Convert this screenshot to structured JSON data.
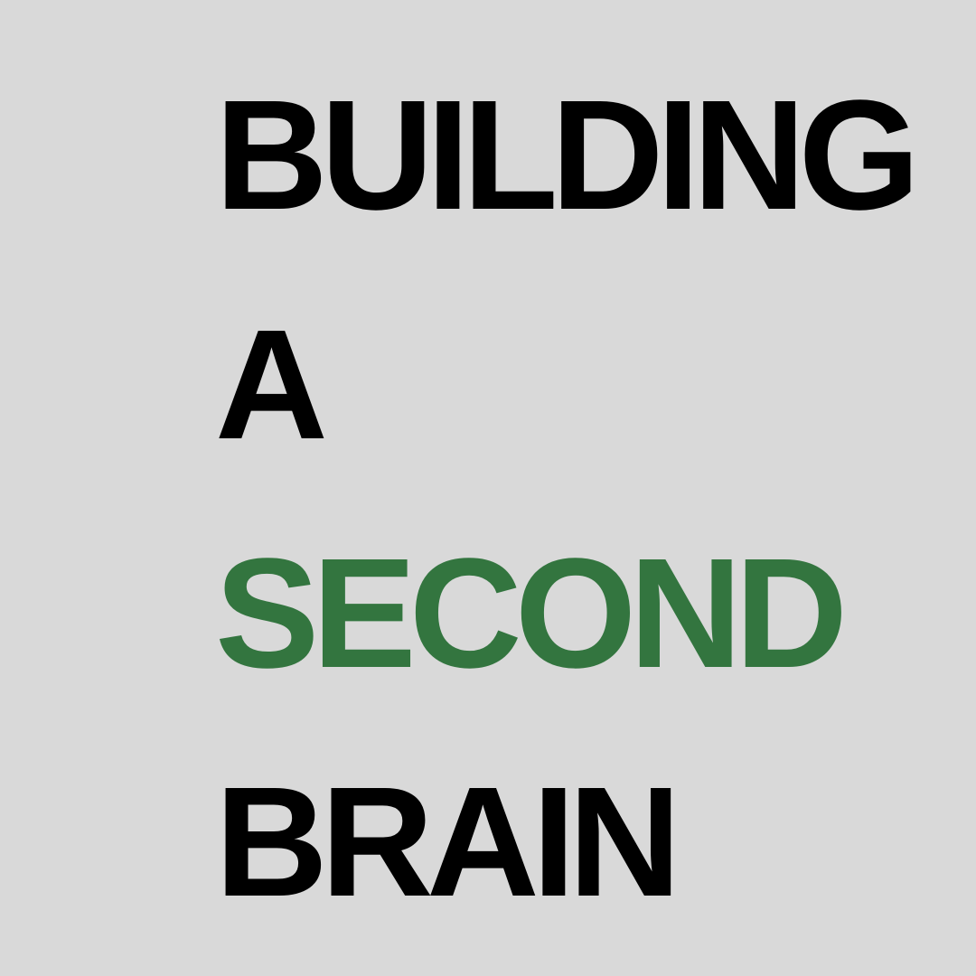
{
  "title_lines": {
    "line1": "BUILDING",
    "line2": "A",
    "line3": "SECOND",
    "line4": "BRAIN"
  },
  "colors": {
    "background": "#d9d9d9",
    "text": "#000000",
    "accent": "#33753f"
  }
}
